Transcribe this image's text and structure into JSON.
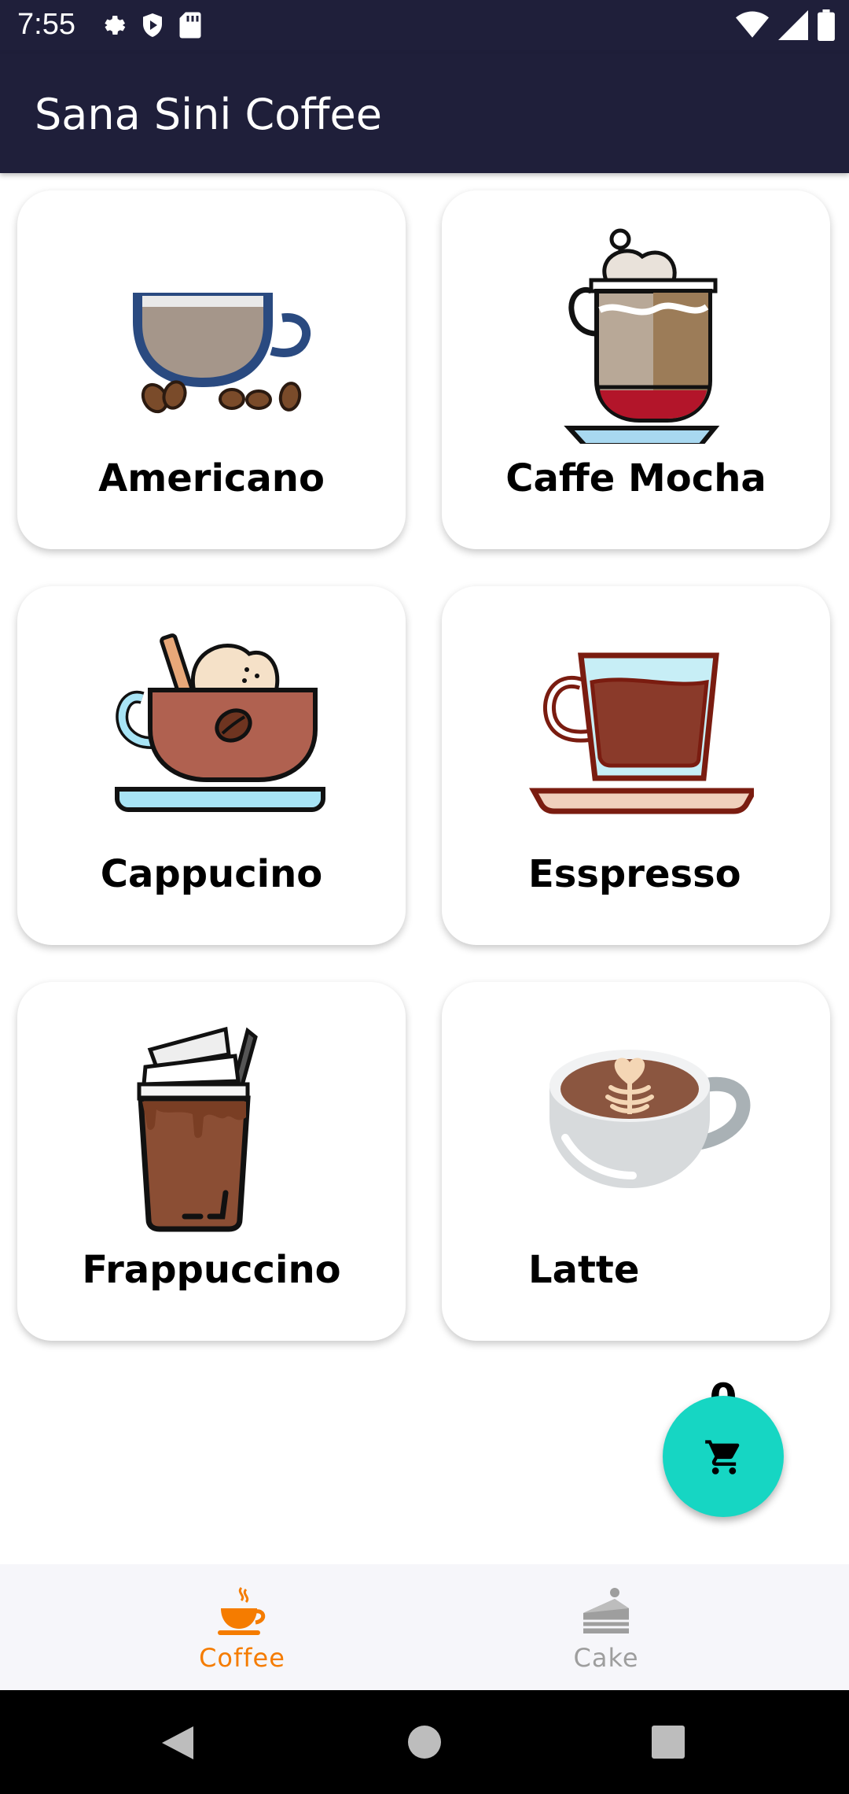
{
  "status_bar": {
    "time": "7:55",
    "left_icons": [
      "gear-icon",
      "shield-play-icon",
      "sd-card-icon"
    ],
    "right_icons": [
      "wifi-icon",
      "signal-icon",
      "battery-icon"
    ]
  },
  "app_bar": {
    "title": "Sana Sini Coffee",
    "background": "#1f1f3a"
  },
  "products": [
    {
      "name": "Americano",
      "icon": "americano-cup-icon"
    },
    {
      "name": "Caffe Mocha",
      "icon": "caffe-mocha-cup-icon"
    },
    {
      "name": "Cappucino",
      "icon": "cappucino-cup-icon"
    },
    {
      "name": "Esspresso",
      "icon": "espresso-cup-icon"
    },
    {
      "name": "Frappuccino",
      "icon": "frappuccino-cup-icon"
    },
    {
      "name": "Latte",
      "icon": "latte-cup-icon"
    }
  ],
  "cart": {
    "count": "0",
    "icon": "shopping-cart-icon",
    "color": "#16d6c3"
  },
  "bottom_nav": {
    "items": [
      {
        "label": "Coffee",
        "icon": "coffee-cup-icon",
        "active": true
      },
      {
        "label": "Cake",
        "icon": "cake-icon",
        "active": false
      }
    ],
    "active_color": "#f57c00",
    "inactive_color": "#9e9e9e"
  },
  "system_nav": [
    "back-icon",
    "home-icon",
    "recents-icon"
  ]
}
